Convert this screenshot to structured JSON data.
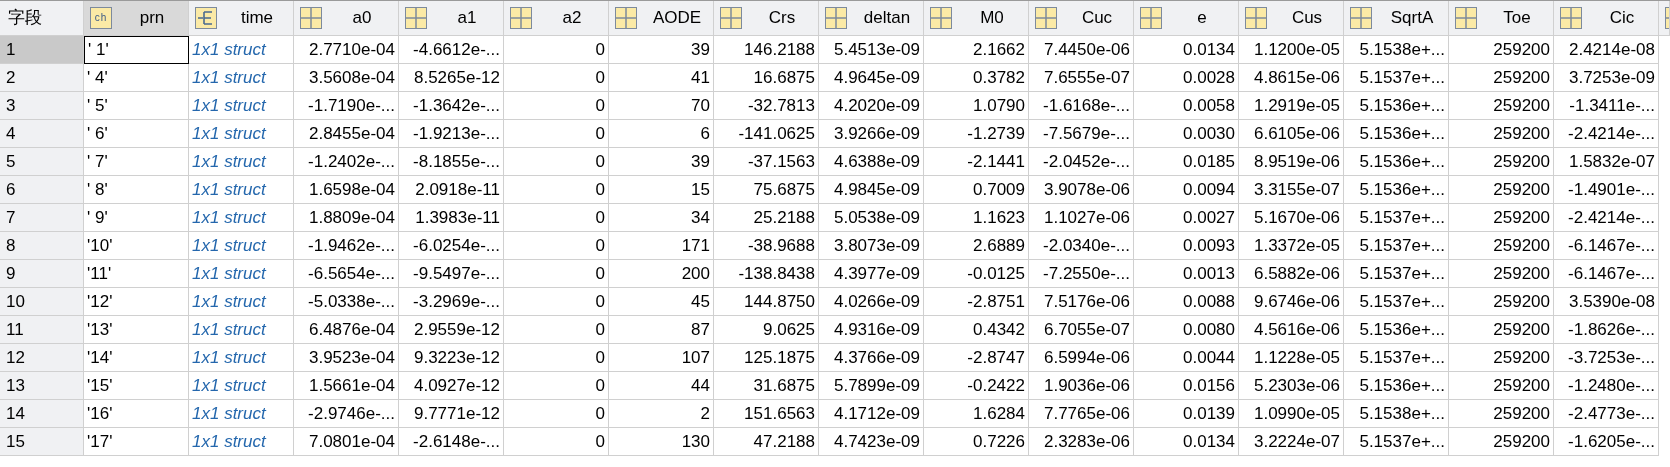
{
  "corner_label": "字段",
  "columns": [
    {
      "name": "prn",
      "kind": "char",
      "icon_label": "ch",
      "selected": true
    },
    {
      "name": "time",
      "kind": "struct",
      "selected": false
    },
    {
      "name": "a0",
      "kind": "numeric",
      "selected": false
    },
    {
      "name": "a1",
      "kind": "numeric",
      "selected": false
    },
    {
      "name": "a2",
      "kind": "numeric",
      "selected": false
    },
    {
      "name": "AODE",
      "kind": "numeric",
      "selected": false
    },
    {
      "name": "Crs",
      "kind": "numeric",
      "selected": false
    },
    {
      "name": "deltan",
      "kind": "numeric",
      "selected": false
    },
    {
      "name": "M0",
      "kind": "numeric",
      "selected": false
    },
    {
      "name": "Cuc",
      "kind": "numeric",
      "selected": false
    },
    {
      "name": "e",
      "kind": "numeric",
      "selected": false
    },
    {
      "name": "Cus",
      "kind": "numeric",
      "selected": false
    },
    {
      "name": "SqrtA",
      "kind": "numeric",
      "selected": false
    },
    {
      "name": "Toe",
      "kind": "numeric",
      "selected": false
    },
    {
      "name": "Cic",
      "kind": "numeric",
      "selected": false
    },
    {
      "kind": "numeric",
      "selected": false
    }
  ],
  "rows": [
    {
      "index": "1",
      "selected": true,
      "cells": [
        "' 1'",
        "1x1 struct",
        "2.7710e-04",
        "-4.6612e-...",
        "0",
        "39",
        "146.2188",
        "5.4513e-09",
        "2.1662",
        "7.4450e-06",
        "0.0134",
        "1.1200e-05",
        "5.1538e+...",
        "259200",
        "2.4214e-08"
      ]
    },
    {
      "index": "2",
      "selected": false,
      "cells": [
        "' 4'",
        "1x1 struct",
        "3.5608e-04",
        "8.5265e-12",
        "0",
        "41",
        "16.6875",
        "4.9645e-09",
        "0.3782",
        "7.6555e-07",
        "0.0028",
        "4.8615e-06",
        "5.1537e+...",
        "259200",
        "3.7253e-09"
      ]
    },
    {
      "index": "3",
      "selected": false,
      "cells": [
        "' 5'",
        "1x1 struct",
        "-1.7190e-...",
        "-1.3642e-...",
        "0",
        "70",
        "-32.7813",
        "4.2020e-09",
        "1.0790",
        "-1.6168e-...",
        "0.0058",
        "1.2919e-05",
        "5.1536e+...",
        "259200",
        "-1.3411e-..."
      ]
    },
    {
      "index": "4",
      "selected": false,
      "cells": [
        "' 6'",
        "1x1 struct",
        "2.8455e-04",
        "-1.9213e-...",
        "0",
        "6",
        "-141.0625",
        "3.9266e-09",
        "-1.2739",
        "-7.5679e-...",
        "0.0030",
        "6.6105e-06",
        "5.1536e+...",
        "259200",
        "-2.4214e-..."
      ]
    },
    {
      "index": "5",
      "selected": false,
      "cells": [
        "' 7'",
        "1x1 struct",
        "-1.2402e-...",
        "-8.1855e-...",
        "0",
        "39",
        "-37.1563",
        "4.6388e-09",
        "-2.1441",
        "-2.0452e-...",
        "0.0185",
        "8.9519e-06",
        "5.1536e+...",
        "259200",
        "1.5832e-07"
      ]
    },
    {
      "index": "6",
      "selected": false,
      "cells": [
        "' 8'",
        "1x1 struct",
        "1.6598e-04",
        "2.0918e-11",
        "0",
        "15",
        "75.6875",
        "4.9845e-09",
        "0.7009",
        "3.9078e-06",
        "0.0094",
        "3.3155e-07",
        "5.1536e+...",
        "259200",
        "-1.4901e-..."
      ]
    },
    {
      "index": "7",
      "selected": false,
      "cells": [
        "' 9'",
        "1x1 struct",
        "1.8809e-04",
        "1.3983e-11",
        "0",
        "34",
        "25.2188",
        "5.0538e-09",
        "1.1623",
        "1.1027e-06",
        "0.0027",
        "5.1670e-06",
        "5.1537e+...",
        "259200",
        "-2.4214e-..."
      ]
    },
    {
      "index": "8",
      "selected": false,
      "cells": [
        "'10'",
        "1x1 struct",
        "-1.9462e-...",
        "-6.0254e-...",
        "0",
        "171",
        "-38.9688",
        "3.8073e-09",
        "2.6889",
        "-2.0340e-...",
        "0.0093",
        "1.3372e-05",
        "5.1537e+...",
        "259200",
        "-6.1467e-..."
      ]
    },
    {
      "index": "9",
      "selected": false,
      "cells": [
        "'11'",
        "1x1 struct",
        "-6.5654e-...",
        "-9.5497e-...",
        "0",
        "200",
        "-138.8438",
        "4.3977e-09",
        "-0.0125",
        "-7.2550e-...",
        "0.0013",
        "6.5882e-06",
        "5.1537e+...",
        "259200",
        "-6.1467e-..."
      ]
    },
    {
      "index": "10",
      "selected": false,
      "cells": [
        "'12'",
        "1x1 struct",
        "-5.0338e-...",
        "-3.2969e-...",
        "0",
        "45",
        "144.8750",
        "4.0266e-09",
        "-2.8751",
        "7.5176e-06",
        "0.0088",
        "9.6746e-06",
        "5.1537e+...",
        "259200",
        "3.5390e-08"
      ]
    },
    {
      "index": "11",
      "selected": false,
      "cells": [
        "'13'",
        "1x1 struct",
        "6.4876e-04",
        "2.9559e-12",
        "0",
        "87",
        "9.0625",
        "4.9316e-09",
        "0.4342",
        "6.7055e-07",
        "0.0080",
        "4.5616e-06",
        "5.1536e+...",
        "259200",
        "-1.8626e-..."
      ]
    },
    {
      "index": "12",
      "selected": false,
      "cells": [
        "'14'",
        "1x1 struct",
        "3.9523e-04",
        "9.3223e-12",
        "0",
        "107",
        "125.1875",
        "4.3766e-09",
        "-2.8747",
        "6.5994e-06",
        "0.0044",
        "1.1228e-05",
        "5.1537e+...",
        "259200",
        "-3.7253e-..."
      ]
    },
    {
      "index": "13",
      "selected": false,
      "cells": [
        "'15'",
        "1x1 struct",
        "1.5661e-04",
        "4.0927e-12",
        "0",
        "44",
        "31.6875",
        "5.7899e-09",
        "-0.2422",
        "1.9036e-06",
        "0.0156",
        "5.2303e-06",
        "5.1536e+...",
        "259200",
        "-1.2480e-..."
      ]
    },
    {
      "index": "14",
      "selected": false,
      "cells": [
        "'16'",
        "1x1 struct",
        "-2.9746e-...",
        "9.7771e-12",
        "0",
        "2",
        "151.6563",
        "4.1712e-09",
        "1.6284",
        "7.7765e-06",
        "0.0139",
        "1.0990e-05",
        "5.1538e+...",
        "259200",
        "-2.4773e-..."
      ]
    },
    {
      "index": "15",
      "selected": false,
      "cells": [
        "'17'",
        "1x1 struct",
        "7.0801e-04",
        "-2.6148e-...",
        "0",
        "130",
        "47.2188",
        "4.7423e-09",
        "0.7226",
        "2.3283e-06",
        "0.0134",
        "3.2224e-07",
        "5.1537e+...",
        "259200",
        "-1.6205e-..."
      ]
    }
  ]
}
